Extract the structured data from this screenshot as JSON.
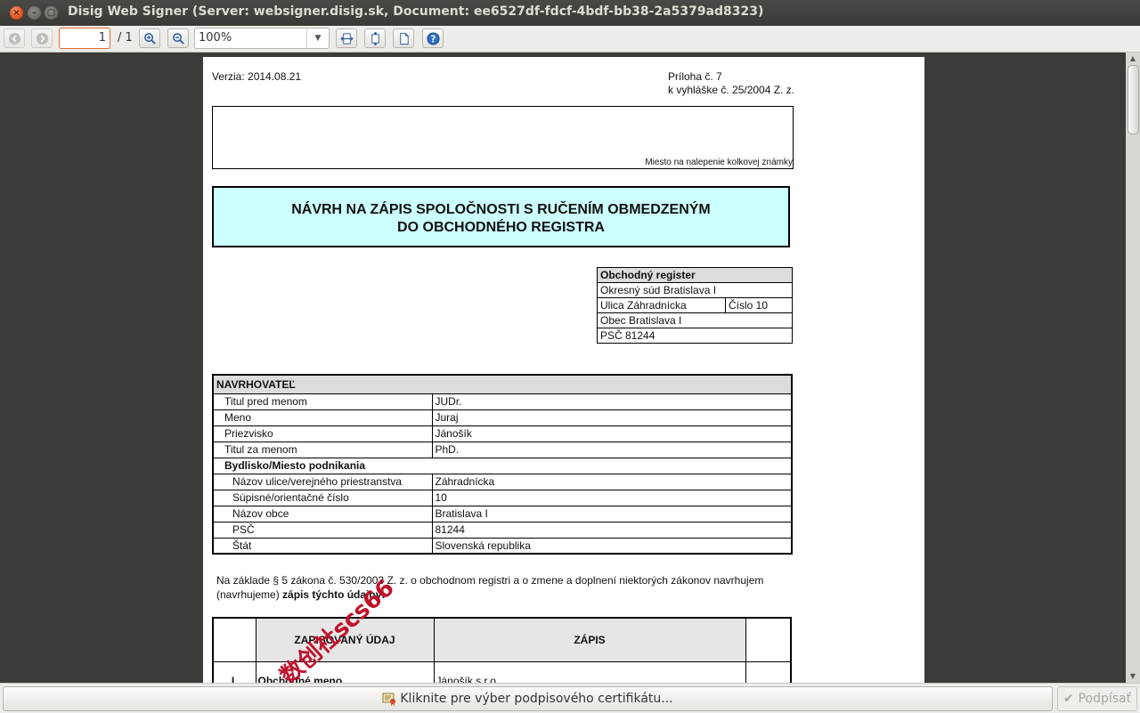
{
  "window": {
    "title": "Disig Web Signer (Server: websigner.disig.sk, Document: ee6527df-fdcf-4bdf-bb38-2a5379ad8323)"
  },
  "toolbar": {
    "page_value": "1",
    "page_total": "/ 1",
    "zoom_value": "100%"
  },
  "document": {
    "verzia": "Verzia: 2014.08.21",
    "priloha_line1": "Príloha č. 7",
    "priloha_line2": "k vyhláške č. 25/2004 Z. z.",
    "stamp_label": "Miesto na nalepenie kolkovej známky",
    "header_line1": "NÁVRH NA ZÁPIS SPOLOČNOSTI S RUČENÍM OBMEDZENÝM",
    "header_line2": "DO OBCHODNÉHO REGISTRA",
    "register": {
      "head": "Obchodný register",
      "court": "Okresný súd Bratislava I",
      "street": "Ulica Záhradnícka",
      "number": "Číslo 10",
      "city": "Obec Bratislava I",
      "psc": "PSČ 81244"
    },
    "navrhovatel": {
      "head": "NAVRHOVATEĽ",
      "rows": [
        {
          "label": "Titul pred menom",
          "value": "JUDr."
        },
        {
          "label": "Meno",
          "value": "Juraj"
        },
        {
          "label": "Priezvisko",
          "value": "Jánošík"
        },
        {
          "label": "Titul za menom",
          "value": "PhD."
        }
      ],
      "bydlisko_head": "Bydlisko/Miesto podnikania",
      "address": [
        {
          "label": "Názov ulice/verejného priestranstva",
          "value": "Záhradnícka"
        },
        {
          "label": "Súpisné/orientačné číslo",
          "value": "10"
        },
        {
          "label": "Názov obce",
          "value": "Bratislava I"
        },
        {
          "label": "PSČ",
          "value": "81244"
        },
        {
          "label": "Štát",
          "value": "Slovenská republika"
        }
      ]
    },
    "para_text": "Na základe § 5 zákona č. 530/2003 Z. z. o obchodnom registri a o zmene a doplnení niektorých zákonov navrhujem (navrhujeme)",
    "para_bold": "zápis týchto údajov:",
    "zapis_table": {
      "col_udaj": "ZAPISOVANÝ ÚDAJ",
      "col_zapis": "ZÁPIS",
      "row_num": "I.",
      "row_label": "Obchodné meno",
      "row_value": "Jánošík s.r.o."
    },
    "watermark": "数创社scs66"
  },
  "bottom": {
    "cert_label": "Kliknite pre výber podpisového certifikátu...",
    "sign_label": "Podpísať"
  }
}
